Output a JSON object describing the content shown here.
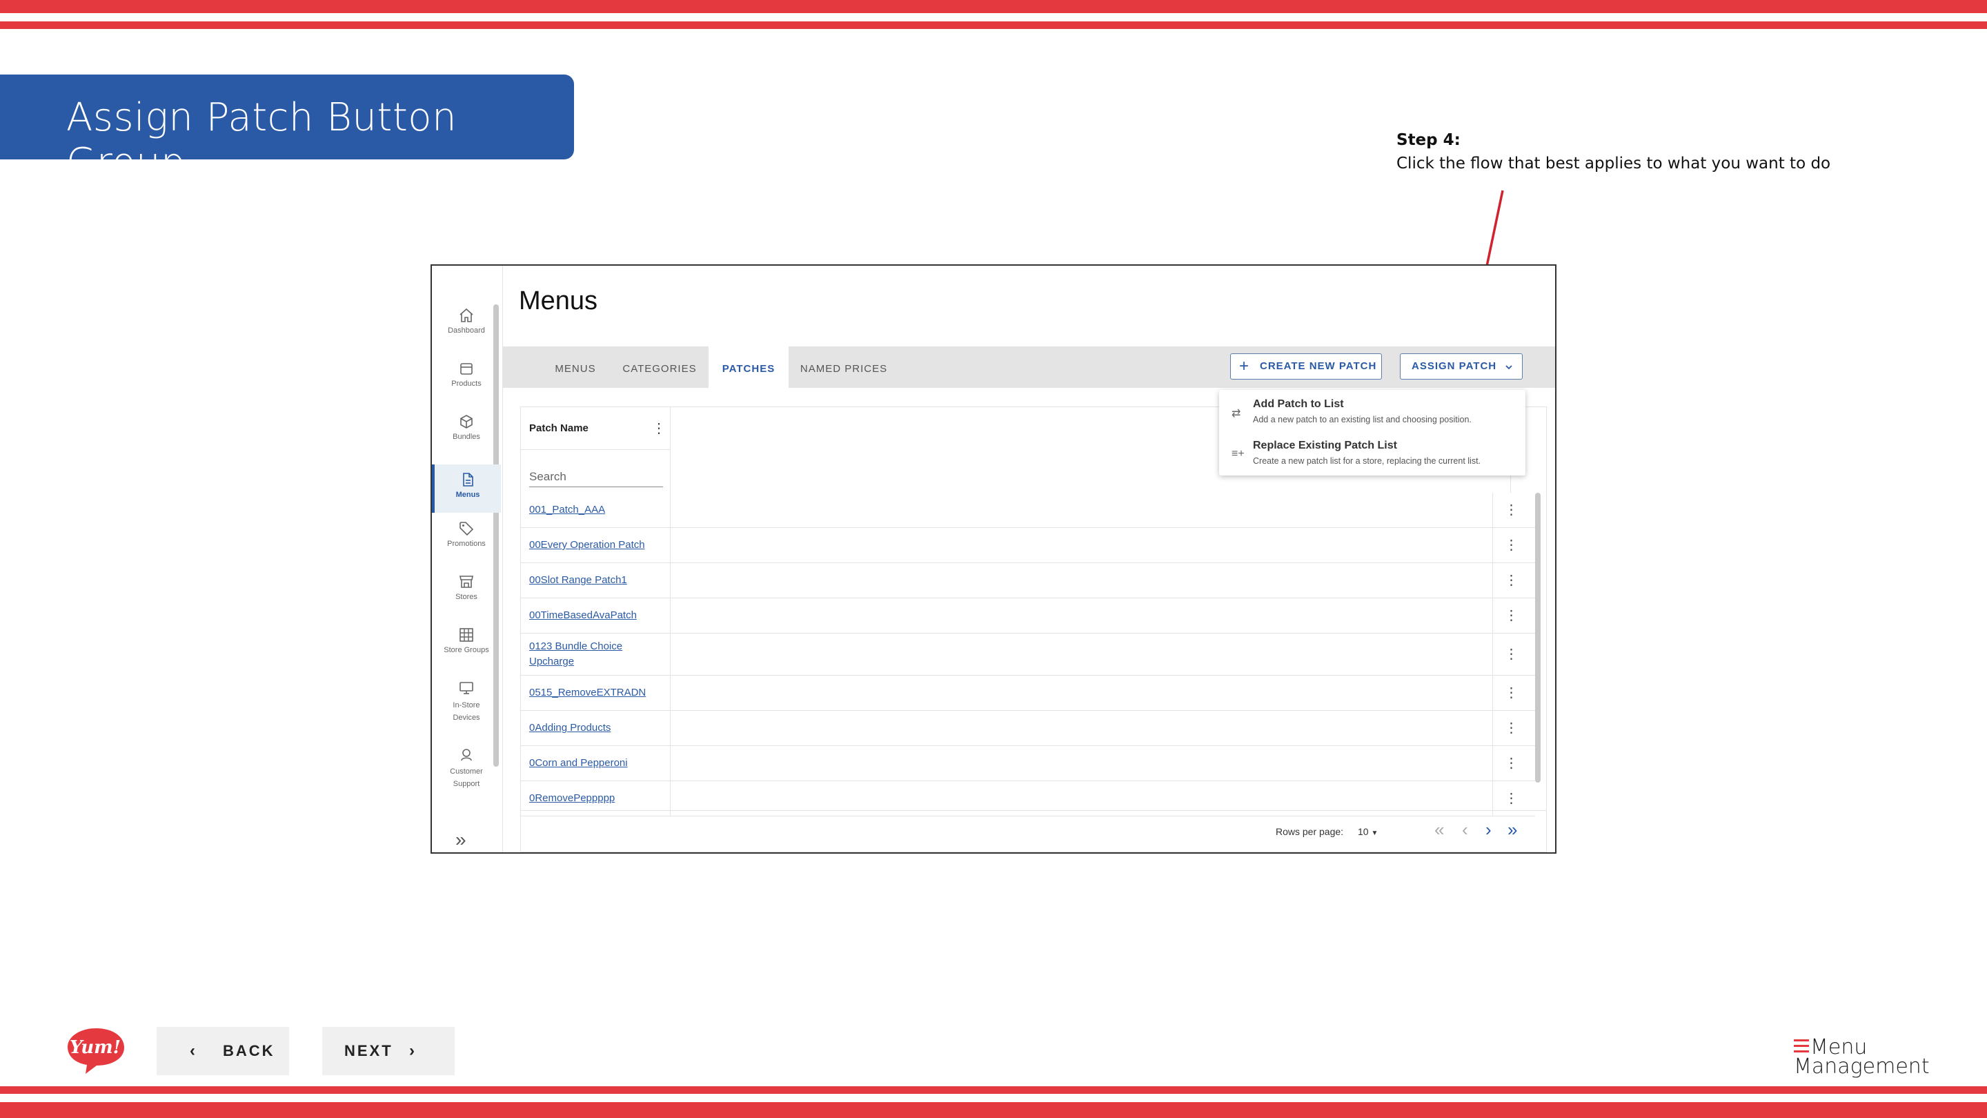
{
  "slide": {
    "title": "Assign Patch Button Group",
    "step_title": "Step 4:",
    "step_text": "Click the flow that best applies to what you want to do",
    "accent_color": "#e4393f",
    "banner_color": "#2a5aa6"
  },
  "app": {
    "page_title": "Menus",
    "sidebar": [
      {
        "label": "Dashboard",
        "icon": "home-icon"
      },
      {
        "label": "Products",
        "icon": "box-icon"
      },
      {
        "label": "Bundles",
        "icon": "cube-icon"
      },
      {
        "label": "Menus",
        "icon": "document-icon",
        "active": true
      },
      {
        "label": "Promotions",
        "icon": "tag-icon"
      },
      {
        "label": "Stores",
        "icon": "store-icon"
      },
      {
        "label": "Store Groups",
        "icon": "grid-icon"
      },
      {
        "label": "In-Store Devices",
        "icon": "monitor-icon"
      },
      {
        "label": "Customer Support",
        "icon": "headset-icon"
      }
    ],
    "tabs": [
      "MENUS",
      "CATEGORIES",
      "PATCHES",
      "NAMED PRICES"
    ],
    "active_tab": "PATCHES",
    "create_button": "CREATE NEW PATCH",
    "assign_button": "ASSIGN PATCH",
    "assign_menu": [
      {
        "title": "Add Patch to List",
        "desc": "Add a new patch to an existing list and choosing position.",
        "icon": "swap-icon"
      },
      {
        "title": "Replace Existing Patch List",
        "desc": "Create a new patch list for a store, replacing the current list.",
        "icon": "playlist-add-icon"
      }
    ],
    "table": {
      "column_header": "Patch Name",
      "search_placeholder": "Search",
      "rows": [
        "001_Patch_AAA",
        "00Every Operation Patch",
        "00Slot Range Patch1",
        "00TimeBasedAvaPatch",
        "0123 Bundle Choice Upcharge",
        "0515_RemoveEXTRADN",
        "0Adding Products",
        "0Corn and Pepperoni",
        "0RemovePeppppp"
      ]
    },
    "pagination": {
      "rows_per_page_label": "Rows per page:",
      "rows_per_page": "10"
    }
  },
  "nav": {
    "back": "BACK",
    "next": "NEXT"
  },
  "logos": {
    "left": "Yum!",
    "right_line1": "Menu",
    "right_line2": "Management"
  }
}
